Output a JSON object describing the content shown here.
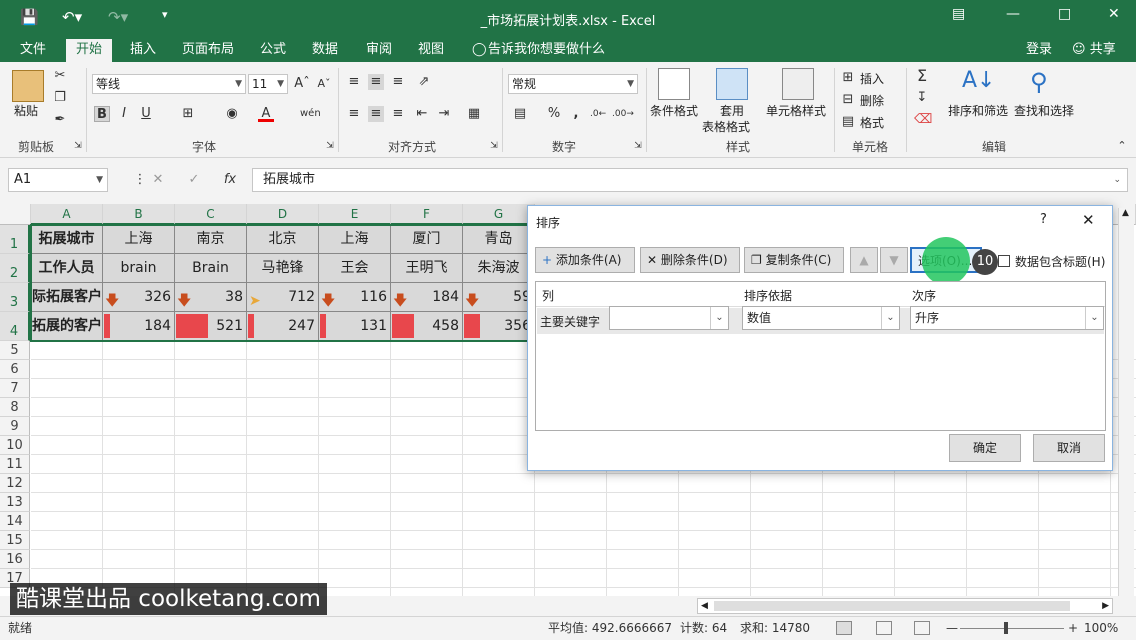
{
  "title": "_市场拓展计划表.xlsx - Excel",
  "tabs": [
    "文件",
    "开始",
    "插入",
    "页面布局",
    "公式",
    "数据",
    "审阅",
    "视图"
  ],
  "tell_me": "告诉我你想要做什么",
  "login": "登录",
  "share": "共享",
  "ribbon": {
    "paste": "粘贴",
    "font_name": "等线",
    "font_size": "11",
    "number_format": "常规",
    "conditional_format": "条件格式",
    "table_format_1": "套用",
    "table_format_2": "表格格式",
    "cell_style": "单元格样式",
    "insert": "插入",
    "delete": "删除",
    "format": "格式",
    "sort_filter": "排序和筛选",
    "find_select": "查找和选择",
    "groups": [
      "剪贴板",
      "字体",
      "对齐方式",
      "数字",
      "样式",
      "单元格",
      "编辑"
    ]
  },
  "formula": {
    "namebox": "A1",
    "fx": "fx",
    "content": "拓展城市"
  },
  "columns": [
    "A",
    "B",
    "C",
    "D",
    "E",
    "F",
    "G"
  ],
  "rows": [
    "1",
    "2",
    "3",
    "4",
    "5",
    "6",
    "7",
    "8",
    "9",
    "10",
    "11",
    "12",
    "13",
    "14",
    "15",
    "16",
    "17"
  ],
  "table": {
    "row1": [
      "拓展城市",
      "上海",
      "南京",
      "北京",
      "上海",
      "厦门",
      "青岛"
    ],
    "row2": [
      "工作人员",
      "brain",
      "Brain",
      "马艳锋",
      "王会",
      "王明飞",
      "朱海波"
    ],
    "row3_label": "际拓展客户",
    "row3": [
      "326",
      "38",
      "712",
      "116",
      "184",
      "59"
    ],
    "row4_label": "拓展的客户",
    "row4": [
      "184",
      "521",
      "247",
      "131",
      "458",
      "356"
    ],
    "row4_levels": [
      0.14,
      1.0,
      0.14,
      0.03,
      0.69,
      0.5
    ]
  },
  "dialog": {
    "title": "排序",
    "help": "?",
    "add": "添加条件(A)",
    "delete": "删除条件(D)",
    "copy": "复制条件(C)",
    "options": "选项(O)...",
    "step": "10",
    "has_header": "数据包含标题(H)",
    "col_header": "列",
    "basis_header": "排序依据",
    "order_header": "次序",
    "primary_key": "主要关键字",
    "basis_value": "数值",
    "order_value": "升序",
    "ok": "确定",
    "cancel": "取消"
  },
  "status": {
    "ready": "就绪",
    "avg": "平均值: 492.6666667",
    "count": "计数: 64",
    "sum": "求和: 14780",
    "zoom": "100%"
  },
  "watermark": "酷课堂出品 coolketang.com",
  "colors": {
    "excel_green": "#217346",
    "bar_red": "#e8474c",
    "highlight": "#22c55e"
  }
}
